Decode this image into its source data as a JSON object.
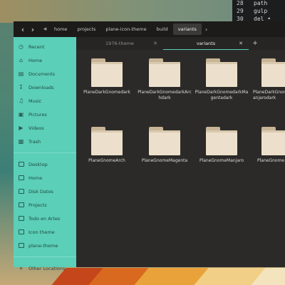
{
  "terminal": {
    "lines": [
      {
        "num": "28",
        "code": "path"
      },
      {
        "num": "29",
        "code": "gulp"
      },
      {
        "num": "30",
        "code": "del •"
      }
    ]
  },
  "pathbar": {
    "crumbs": [
      "home",
      "projects",
      "plane-icon-theme",
      "build",
      "variants"
    ]
  },
  "tabs": [
    {
      "label": "1976-theme"
    },
    {
      "label": "variants"
    }
  ],
  "sidebar": {
    "places": [
      {
        "label": "Recent",
        "icon": "clock-icon"
      },
      {
        "label": "Home",
        "icon": "home-icon"
      },
      {
        "label": "Documents",
        "icon": "document-icon"
      },
      {
        "label": "Downloads",
        "icon": "download-icon"
      },
      {
        "label": "Music",
        "icon": "music-icon"
      },
      {
        "label": "Pictures",
        "icon": "picture-icon"
      },
      {
        "label": "Videos",
        "icon": "video-icon"
      },
      {
        "label": "Trash",
        "icon": "trash-icon"
      }
    ],
    "bookmarks": [
      {
        "label": "Desktop"
      },
      {
        "label": "Home"
      },
      {
        "label": "Disk Datos"
      },
      {
        "label": "Projects"
      },
      {
        "label": "Todo en Artes"
      },
      {
        "label": "Icon theme"
      },
      {
        "label": "plane-theme"
      }
    ],
    "other": {
      "label": "Other Locations"
    }
  },
  "files": [
    {
      "name": "PlaneDarkGnomedark"
    },
    {
      "name": "PlaneDarkGnomedarkArchdark"
    },
    {
      "name": "PlaneDarkGnomedarkMagentadark"
    },
    {
      "name": "PlaneDarkGnomedarkManjarodark"
    },
    {
      "name": "PlaneGnomeArch"
    },
    {
      "name": "PlaneGnomeMagenta"
    },
    {
      "name": "PlaneGnomeManjaro"
    },
    {
      "name": "PlaneGnome"
    }
  ],
  "colors": {
    "sidebar_bg": "#5bcfb8",
    "window_bg": "#2b2a28",
    "folder": "#ece0cc"
  }
}
